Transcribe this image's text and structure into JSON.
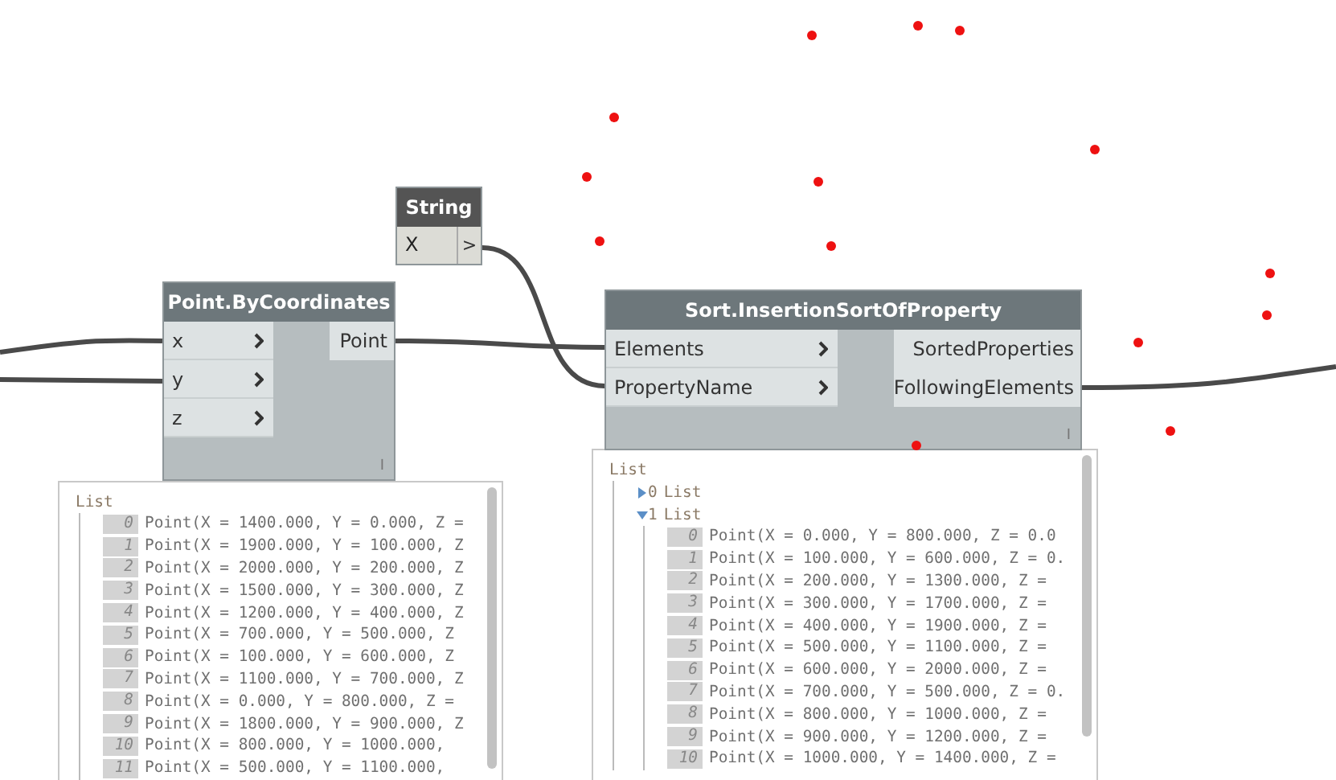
{
  "nodes": [
    {
      "kind": "string",
      "title": "String",
      "value": "X",
      "output": ">"
    },
    {
      "kind": "function",
      "title": "Point.ByCoordinates",
      "inputs": [
        "x",
        "y",
        "z"
      ],
      "outputs": [
        "Point"
      ],
      "lacing": "I"
    },
    {
      "kind": "function",
      "title": "Sort.InsertionSortOfProperty",
      "inputs": [
        "Elements",
        "PropertyName"
      ],
      "outputs": [
        "SortedProperties",
        "FollowingElements"
      ],
      "lacing": "I"
    }
  ],
  "previews": [
    {
      "label": "List",
      "items": [
        {
          "index": "0",
          "text": "Point(X = 1400.000, Y = 0.000, Z ="
        },
        {
          "index": "1",
          "text": "Point(X = 1900.000, Y = 100.000, Z"
        },
        {
          "index": "2",
          "text": "Point(X = 2000.000, Y = 200.000, Z"
        },
        {
          "index": "3",
          "text": "Point(X = 1500.000, Y = 300.000, Z"
        },
        {
          "index": "4",
          "text": "Point(X = 1200.000, Y = 400.000, Z"
        },
        {
          "index": "5",
          "text": "Point(X = 700.000, Y = 500.000, Z"
        },
        {
          "index": "6",
          "text": "Point(X = 100.000, Y = 600.000, Z"
        },
        {
          "index": "7",
          "text": "Point(X = 1100.000, Y = 700.000, Z"
        },
        {
          "index": "8",
          "text": "Point(X = 0.000, Y = 800.000, Z ="
        },
        {
          "index": "9",
          "text": "Point(X = 1800.000, Y = 900.000, Z"
        },
        {
          "index": "10",
          "text": "Point(X = 800.000, Y = 1000.000,"
        },
        {
          "index": "11",
          "text": "Point(X = 500.000, Y = 1100.000,"
        }
      ]
    },
    {
      "label": "List",
      "children": [
        {
          "index": "0",
          "label": "List",
          "expanded": false
        },
        {
          "index": "1",
          "label": "List",
          "expanded": true,
          "items": [
            {
              "index": "0",
              "text": "Point(X = 0.000, Y = 800.000, Z = 0.0"
            },
            {
              "index": "1",
              "text": "Point(X = 100.000, Y = 600.000, Z = 0."
            },
            {
              "index": "2",
              "text": "Point(X = 200.000, Y = 1300.000, Z ="
            },
            {
              "index": "3",
              "text": "Point(X = 300.000, Y = 1700.000, Z ="
            },
            {
              "index": "4",
              "text": "Point(X = 400.000, Y = 1900.000, Z ="
            },
            {
              "index": "5",
              "text": "Point(X = 500.000, Y = 1100.000, Z ="
            },
            {
              "index": "6",
              "text": "Point(X = 600.000, Y = 2000.000, Z ="
            },
            {
              "index": "7",
              "text": "Point(X = 700.000, Y = 500.000, Z = 0."
            },
            {
              "index": "8",
              "text": "Point(X = 800.000, Y = 1000.000, Z ="
            },
            {
              "index": "9",
              "text": "Point(X = 900.000, Y = 1200.000, Z ="
            },
            {
              "index": "10",
              "text": "Point(X = 1000.000, Y = 1400.000, Z ="
            }
          ]
        }
      ]
    }
  ]
}
